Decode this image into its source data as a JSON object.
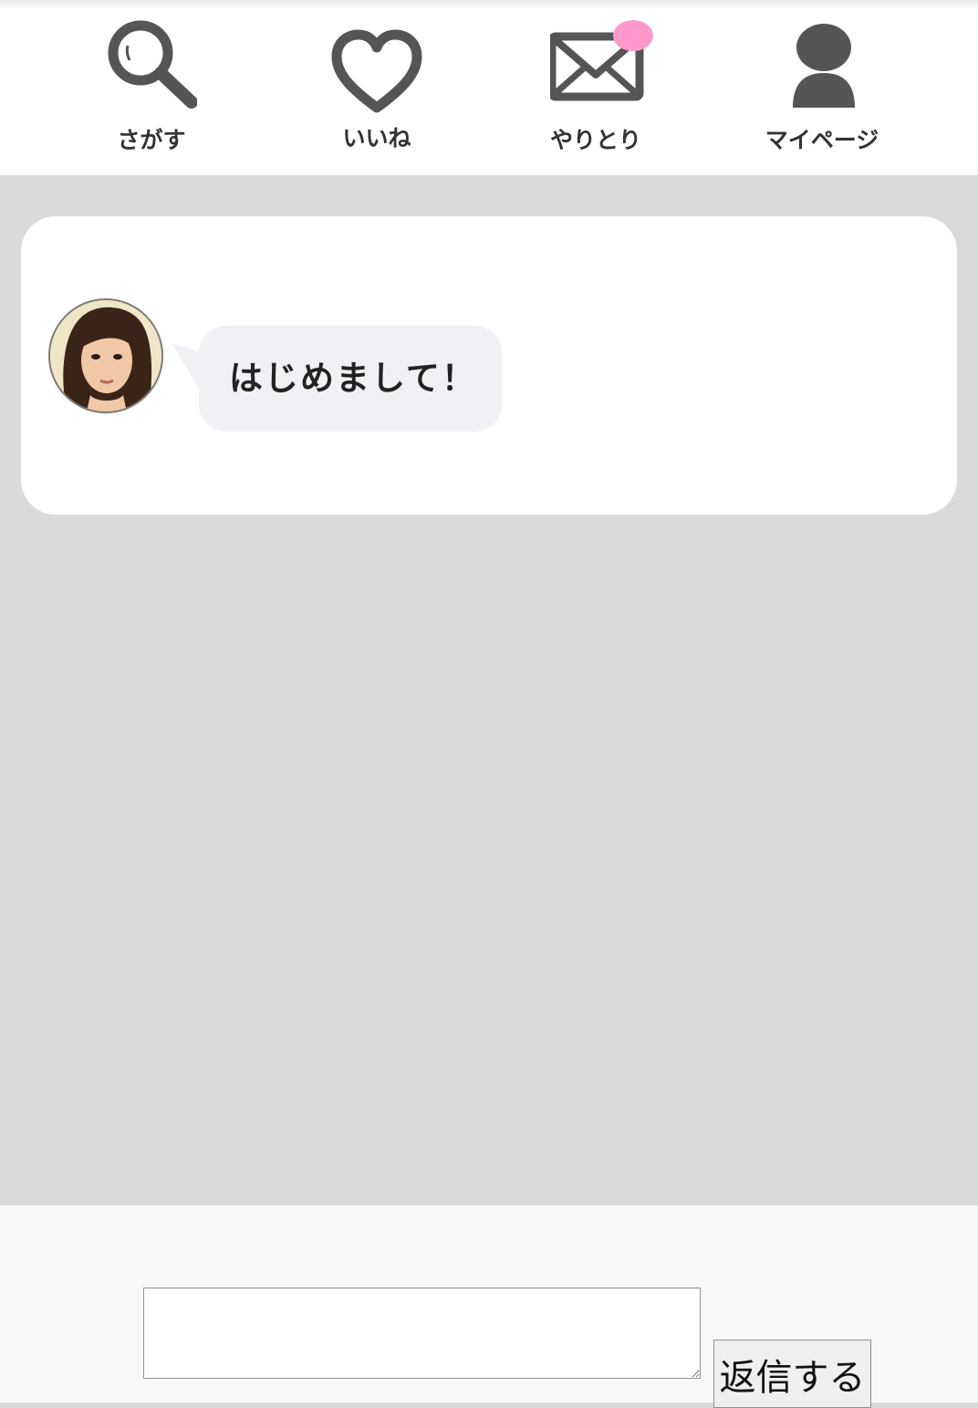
{
  "nav": {
    "items": [
      {
        "label": "さがす",
        "icon": "search-icon"
      },
      {
        "label": "いいね",
        "icon": "heart-icon"
      },
      {
        "label": "やりとり",
        "icon": "mail-icon",
        "badge": true
      },
      {
        "label": "マイページ",
        "icon": "user-icon"
      }
    ]
  },
  "chat": {
    "messages": [
      {
        "sender": "partner",
        "text": "はじめまして！"
      }
    ]
  },
  "reply": {
    "input_value": "",
    "button_label": "返信する"
  },
  "colors": {
    "icon_gray": "#555555",
    "badge_pink": "#ff99cc",
    "page_bg": "#dadada",
    "bubble_bg": "#f0f1f5"
  }
}
